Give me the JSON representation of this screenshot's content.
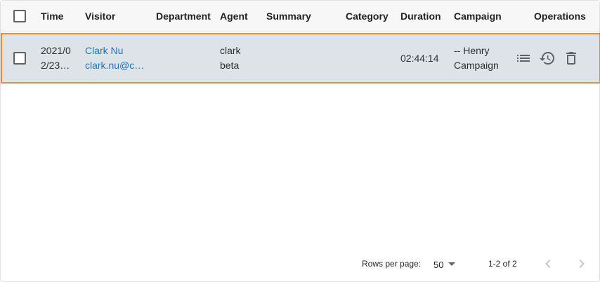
{
  "table": {
    "columns": [
      "Time",
      "Visitor",
      "Department",
      "Agent",
      "Summary",
      "Category",
      "Duration",
      "Campaign",
      "Operations"
    ],
    "rows": [
      {
        "time_line1": "2021/0",
        "time_line2": "2/23…",
        "visitor_name": "Clark Nu",
        "visitor_email": "clark.nu@c…",
        "department": "",
        "agent_line1": "clark",
        "agent_line2": "beta",
        "summary": "",
        "category": "",
        "duration": "02:44:14",
        "campaign_line1": "-- Henry",
        "campaign_line2": "Campaign"
      }
    ]
  },
  "icons": {
    "details": "list-icon",
    "history": "history-icon",
    "delete": "delete-icon"
  },
  "pagination": {
    "rows_per_page_label": "Rows per page:",
    "rows_per_page_value": "50",
    "range_text": "1-2 of 2"
  },
  "colors": {
    "row_highlight_border": "#f0883e",
    "row_background": "#dde3e6",
    "link": "#1a73c8"
  }
}
